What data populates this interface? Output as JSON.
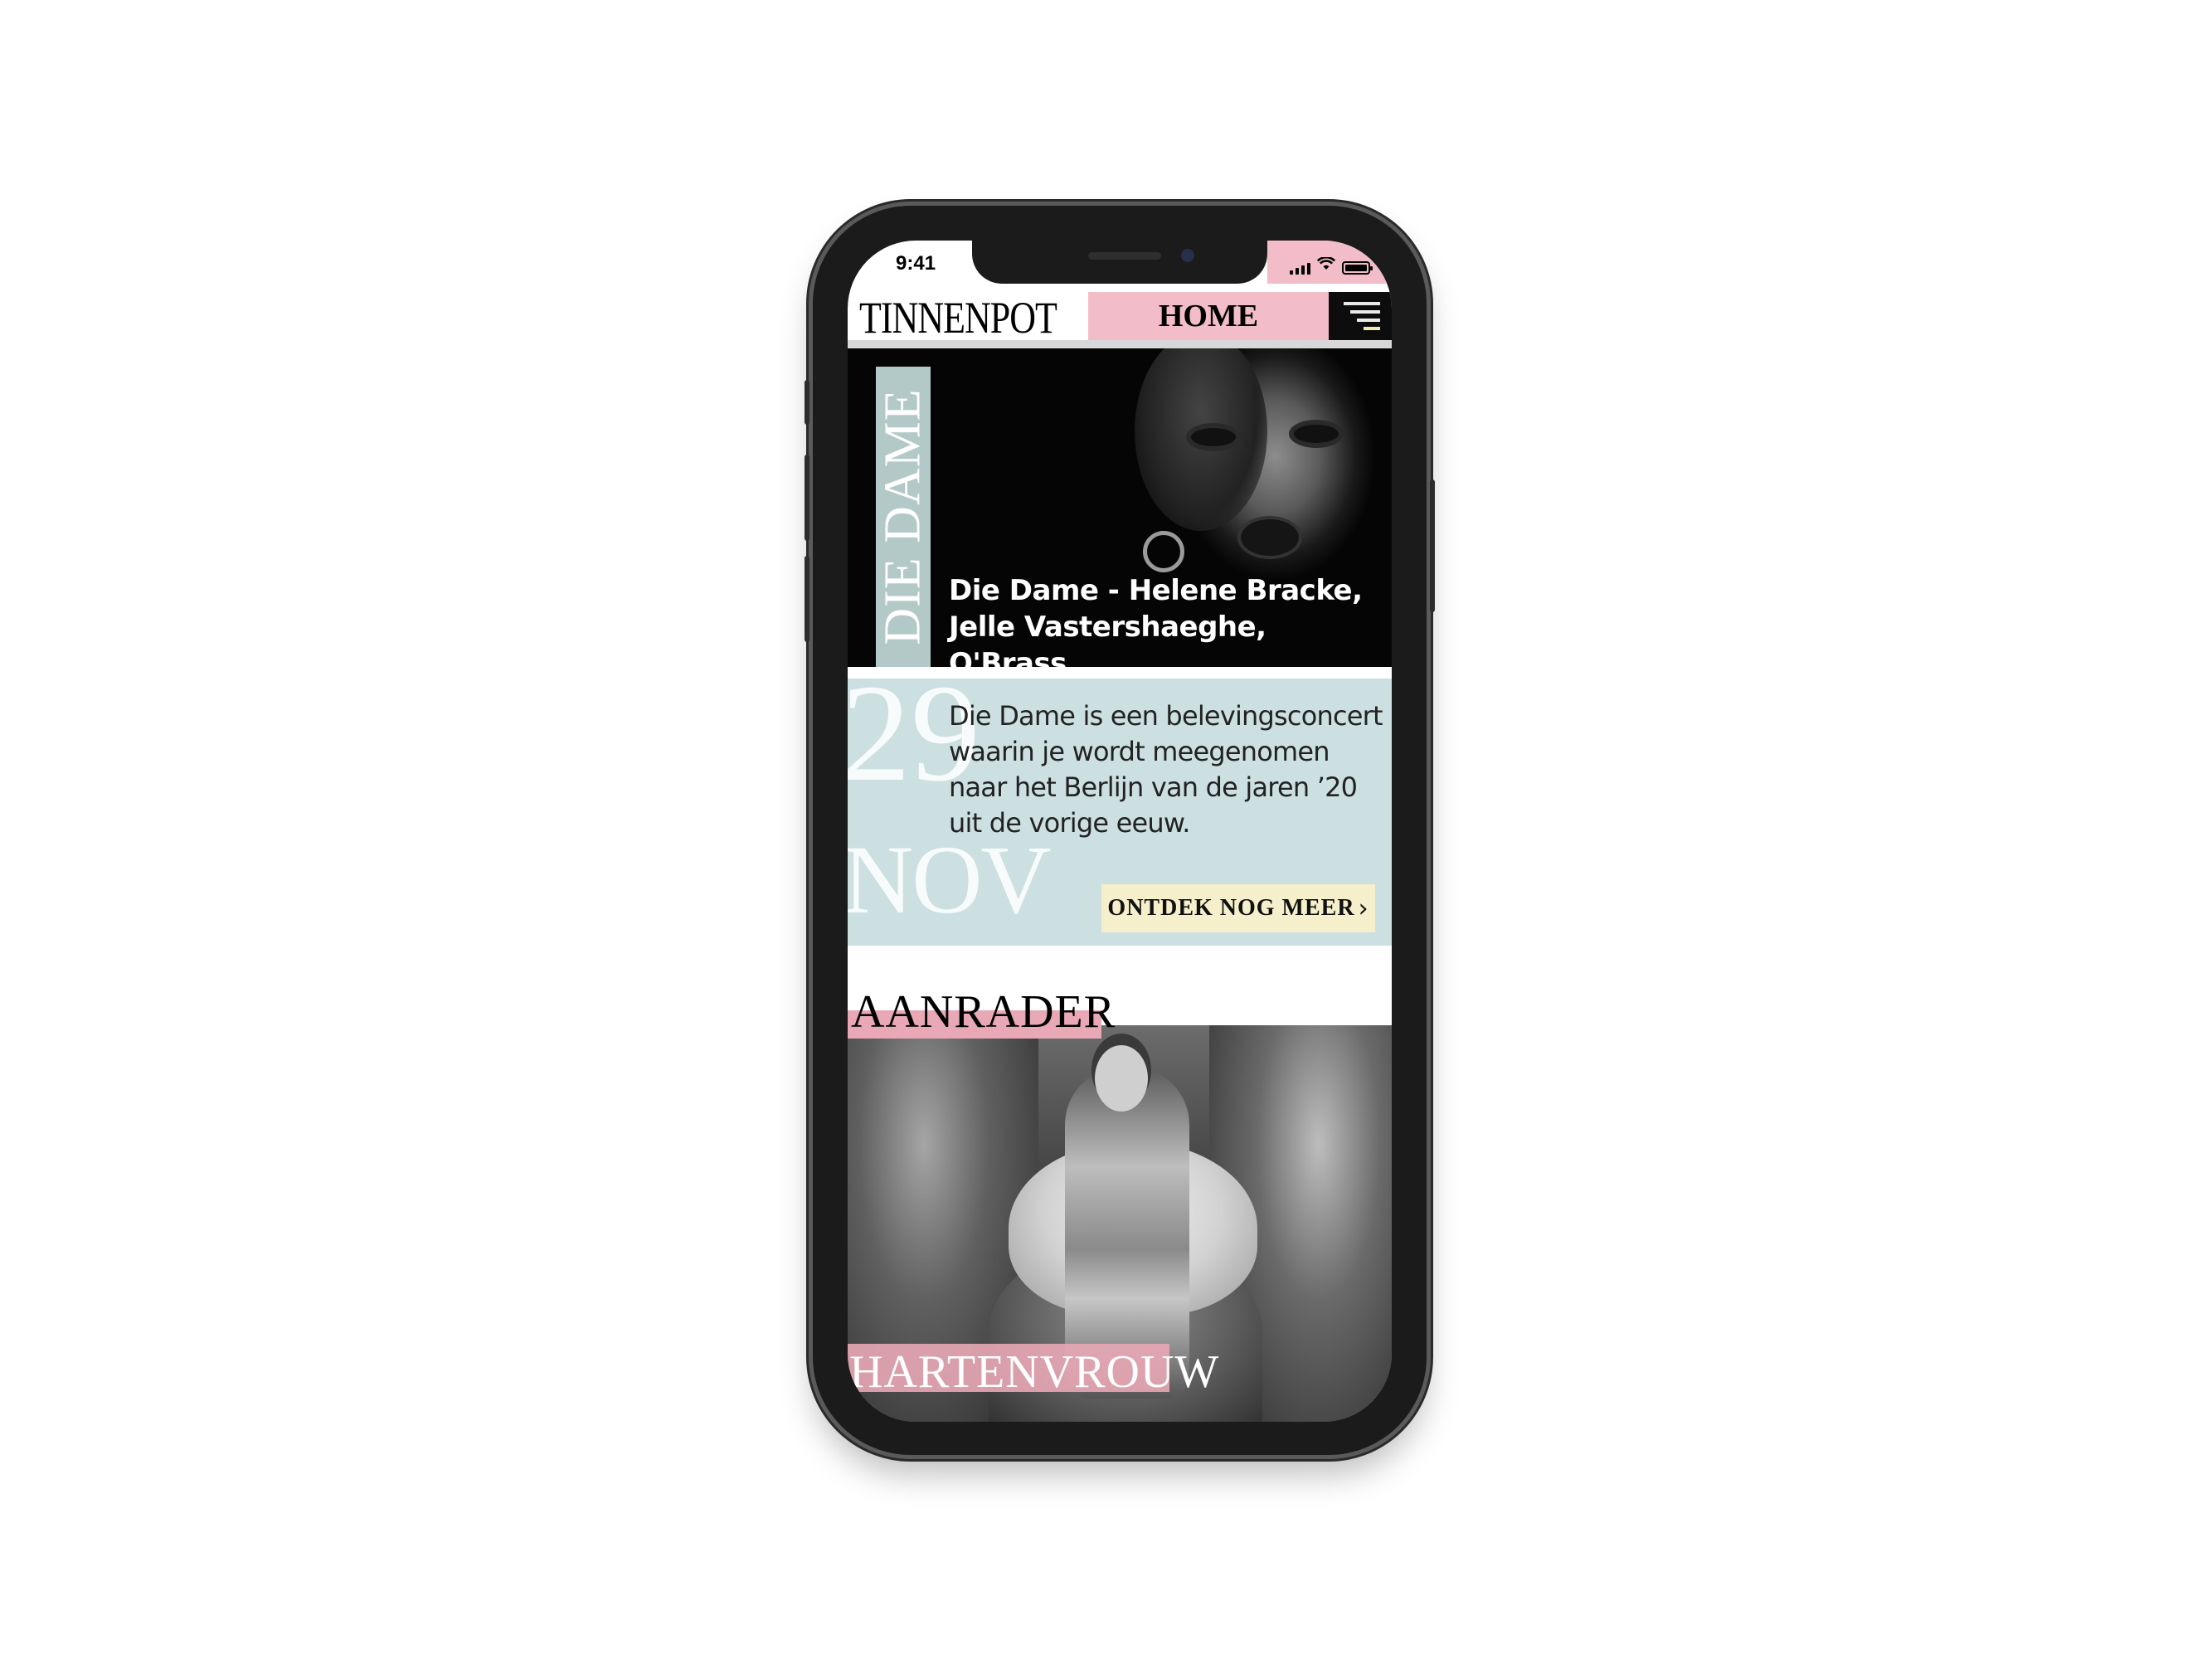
{
  "status_bar": {
    "time": "9:41",
    "signal_icon": "signal-bars-icon",
    "wifi_icon": "wifi-icon",
    "battery_icon": "battery-icon"
  },
  "header": {
    "logo": "TINNENPOT",
    "nav_label": "HOME",
    "menu_icon": "hamburger-menu-icon"
  },
  "hero": {
    "tag": "DIE DAME",
    "title_line1": "Die Dame - Helene Bracke,",
    "title_line2": "Jelle Vastershaeghe, O'Brass"
  },
  "event": {
    "day": "29",
    "month": "NOV",
    "description_lines": [
      "Die Dame is een belevingsconcert",
      "waarin je wordt meegenomen",
      "naar het Berlijn van de jaren ’20",
      "uit de vorige eeuw."
    ],
    "cta_label": "ONTDEK NOG MEER",
    "cta_icon": "chevron-right-icon"
  },
  "featured": {
    "section_label": "AANRADER",
    "title": "HARTENVROUW"
  },
  "colors": {
    "pink_accent": "#f2bdc8",
    "mint_accent": "#b3c9c7",
    "info_background": "#cde0e1",
    "cta_background": "#f6efcb",
    "dark": "#0d0d0d"
  }
}
